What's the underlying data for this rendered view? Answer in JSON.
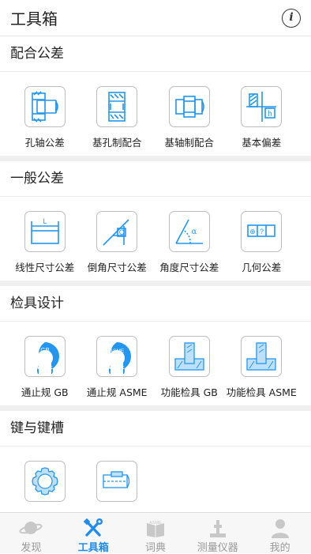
{
  "header": {
    "title": "工具箱",
    "info_icon": "info-icon",
    "info_glyph": "i"
  },
  "sections": [
    {
      "title": "配合公差",
      "items": [
        {
          "label": "孔轴公差",
          "icon": "hole-shaft-tolerance-icon"
        },
        {
          "label": "基孔制配合",
          "icon": "hole-basis-fit-icon"
        },
        {
          "label": "基轴制配合",
          "icon": "shaft-basis-fit-icon"
        },
        {
          "label": "基本偏差",
          "icon": "fundamental-deviation-icon"
        }
      ]
    },
    {
      "title": "一般公差",
      "items": [
        {
          "label": "线性尺寸公差",
          "icon": "linear-dimension-icon"
        },
        {
          "label": "倒角尺寸公差",
          "icon": "chamfer-dimension-icon"
        },
        {
          "label": "角度尺寸公差",
          "icon": "angle-dimension-icon"
        },
        {
          "label": "几何公差",
          "icon": "geometric-tolerance-icon"
        }
      ]
    },
    {
      "title": "检具设计",
      "items": [
        {
          "label": "通止规 GB",
          "icon": "go-nogo-gauge-gb-icon"
        },
        {
          "label": "通止规 ASME",
          "icon": "go-nogo-gauge-asme-icon"
        },
        {
          "label": "功能检具 GB",
          "icon": "functional-gauge-gb-icon"
        },
        {
          "label": "功能检具 ASME",
          "icon": "functional-gauge-asme-icon"
        }
      ]
    },
    {
      "title": "键与键槽",
      "items": [
        {
          "label": "",
          "icon": "spline-icon"
        },
        {
          "label": "",
          "icon": "key-keyway-icon"
        }
      ]
    }
  ],
  "icon_text": {
    "linear": "L",
    "chamfer": "C",
    "angle": "α",
    "geometric_symbol": "⊕",
    "geometric_q": "?",
    "basic_dev": "h",
    "gauge_gb": "GB",
    "gauge_asme": "ASME"
  },
  "tabs": [
    {
      "label": "发现",
      "icon": "planet-icon",
      "active": false
    },
    {
      "label": "工具箱",
      "icon": "tools-icon",
      "active": true
    },
    {
      "label": "词典",
      "icon": "dictionary-icon",
      "active": false
    },
    {
      "label": "测量仪器",
      "icon": "measuring-instrument-icon",
      "active": false
    },
    {
      "label": "我的",
      "icon": "user-icon",
      "active": false
    }
  ],
  "colors": {
    "accent": "#1e8cf0",
    "icon_blue": "#2196f3",
    "inactive": "#999999",
    "divider": "#efefef"
  }
}
